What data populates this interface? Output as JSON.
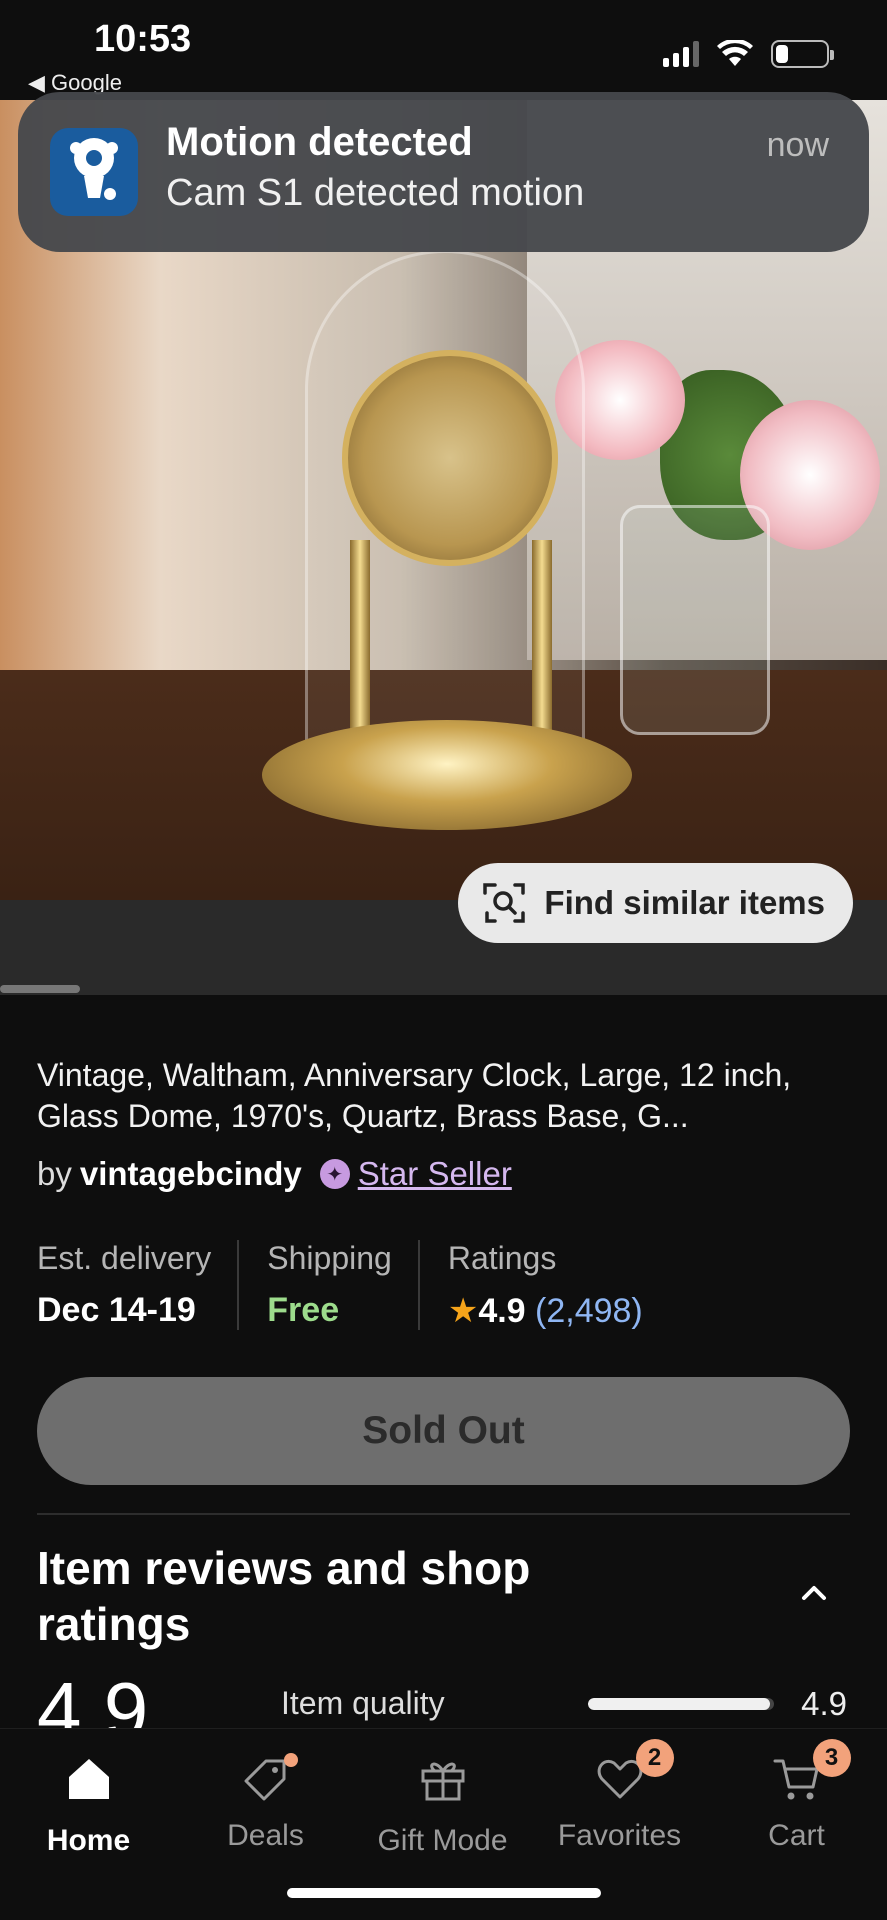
{
  "status_bar": {
    "time": "10:53",
    "back_label": "◀ Google",
    "battery_level": 0.25
  },
  "notification": {
    "title": "Motion detected",
    "body": "Cam S1 detected motion",
    "time": "now"
  },
  "hero": {
    "find_similar_label": "Find similar items"
  },
  "product": {
    "title": "Vintage, Waltham, Anniversary Clock, Large, 12 inch, Glass Dome, 1970's, Quartz, Brass Base, G...",
    "by_label": "by",
    "seller_name": "vintagebcindy",
    "star_seller_label": "Star Seller",
    "delivery_label": "Est. delivery",
    "delivery_value": "Dec 14-19",
    "shipping_label": "Shipping",
    "shipping_value": "Free",
    "ratings_label": "Ratings",
    "rating_value": "4.9",
    "rating_count": "(2,498)",
    "sold_out_label": "Sold Out"
  },
  "reviews": {
    "title": "Item reviews and shop ratings",
    "overall": "4.9",
    "item_quality_label": "Item quality",
    "item_quality_value": "4.9",
    "item_quality_fraction": 0.98
  },
  "tabs": [
    {
      "label": "Home",
      "icon": "home-icon",
      "active": true
    },
    {
      "label": "Deals",
      "icon": "tag-icon"
    },
    {
      "label": "Gift Mode",
      "icon": "gift-icon"
    },
    {
      "label": "Favorites",
      "icon": "heart-icon",
      "badge": "2"
    },
    {
      "label": "Cart",
      "icon": "cart-icon",
      "badge": "3"
    }
  ],
  "colors": {
    "accent_badge": "#f2a27b",
    "free_green": "#9ddc8c",
    "rating_star": "#f6a41a",
    "star_seller": "#d5b8ef"
  }
}
